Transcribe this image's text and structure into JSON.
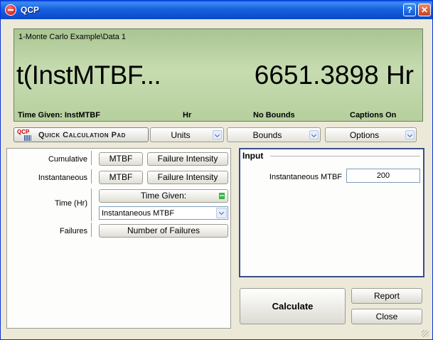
{
  "window": {
    "title": "QCP",
    "help_label": "?",
    "close_label": "✕"
  },
  "display": {
    "path": "1-Monte Carlo Example\\Data 1",
    "expression": "t(InstMTBF...",
    "result": "6651.3898 Hr",
    "status": {
      "time_given": "Time Given: InstMTBF",
      "unit": "Hr",
      "bounds": "No Bounds",
      "captions": "Captions On"
    },
    "background_color": "#c6dcb0"
  },
  "toolbar": {
    "qcp_logo_text": "QCP",
    "qcp_label": "Quick Calculation Pad",
    "units_label": "Units",
    "bounds_label": "Bounds",
    "options_label": "Options"
  },
  "calc_options": {
    "cumulative_label": "Cumulative",
    "instantaneous_label": "Instantaneous",
    "time_label": "Time (Hr)",
    "failures_label": "Failures",
    "cumulative_mtbf": "MTBF",
    "cumulative_failure_intensity": "Failure Intensity",
    "instantaneous_mtbf": "MTBF",
    "instantaneous_failure_intensity": "Failure Intensity",
    "time_given_button": "Time Given:",
    "time_given_select": "Instantaneous MTBF",
    "number_of_failures": "Number of Failures"
  },
  "input": {
    "title": "Input",
    "field_label": "Instantaneous MTBF",
    "field_value": "200"
  },
  "actions": {
    "calculate": "Calculate",
    "report": "Report",
    "close": "Close"
  },
  "colors": {
    "titlebar": "#1761e0",
    "input_border": "#3a4d8c",
    "indicator": "#3bb54a"
  }
}
